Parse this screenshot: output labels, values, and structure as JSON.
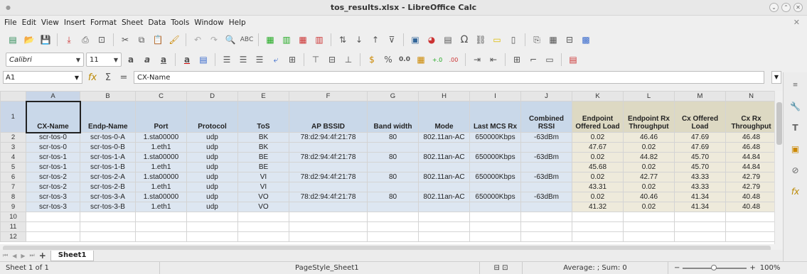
{
  "window": {
    "title": "tos_results.xlsx - LibreOffice Calc"
  },
  "menu": [
    "File",
    "Edit",
    "View",
    "Insert",
    "Format",
    "Sheet",
    "Data",
    "Tools",
    "Window",
    "Help"
  ],
  "format": {
    "font_name": "Calibri",
    "font_size": "11"
  },
  "formula": {
    "cell_ref": "A1",
    "content": "CX-Name"
  },
  "columns": [
    "A",
    "B",
    "C",
    "D",
    "E",
    "F",
    "G",
    "H",
    "I",
    "J",
    "K",
    "L",
    "M",
    "N"
  ],
  "headers": [
    "CX-Name",
    "Endp-Name",
    "Port",
    "Protocol",
    "ToS",
    "AP BSSID",
    "Band width",
    "Mode",
    "Last MCS Rx",
    "Combined RSSI",
    "Endpoint Offered Load",
    "Endpoint Rx Throughput",
    "Cx Offered Load",
    "Cx Rx Throughput"
  ],
  "rows": [
    {
      "num": "2",
      "cells": [
        "scr-tos-0",
        "scr-tos-0-A",
        "1.sta00000",
        "udp",
        "BK",
        "78:d2:94:4f:21:78",
        "80",
        "802.11an-AC",
        "650000Kbps",
        "-63dBm",
        "0.02",
        "46.46",
        "47.69",
        "46.48"
      ]
    },
    {
      "num": "3",
      "cells": [
        "scr-tos-0",
        "scr-tos-0-B",
        "1.eth1",
        "udp",
        "BK",
        "",
        "",
        "",
        "",
        "",
        "47.67",
        "0.02",
        "47.69",
        "46.48"
      ]
    },
    {
      "num": "4",
      "cells": [
        "scr-tos-1",
        "scr-tos-1-A",
        "1.sta00000",
        "udp",
        "BE",
        "78:d2:94:4f:21:78",
        "80",
        "802.11an-AC",
        "650000Kbps",
        "-63dBm",
        "0.02",
        "44.82",
        "45.70",
        "44.84"
      ]
    },
    {
      "num": "5",
      "cells": [
        "scr-tos-1",
        "scr-tos-1-B",
        "1.eth1",
        "udp",
        "BE",
        "",
        "",
        "",
        "",
        "",
        "45.68",
        "0.02",
        "45.70",
        "44.84"
      ]
    },
    {
      "num": "6",
      "cells": [
        "scr-tos-2",
        "scr-tos-2-A",
        "1.sta00000",
        "udp",
        "VI",
        "78:d2:94:4f:21:78",
        "80",
        "802.11an-AC",
        "650000Kbps",
        "-63dBm",
        "0.02",
        "42.77",
        "43.33",
        "42.79"
      ]
    },
    {
      "num": "7",
      "cells": [
        "scr-tos-2",
        "scr-tos-2-B",
        "1.eth1",
        "udp",
        "VI",
        "",
        "",
        "",
        "",
        "",
        "43.31",
        "0.02",
        "43.33",
        "42.79"
      ]
    },
    {
      "num": "8",
      "cells": [
        "scr-tos-3",
        "scr-tos-3-A",
        "1.sta00000",
        "udp",
        "VO",
        "78:d2:94:4f:21:78",
        "80",
        "802.11an-AC",
        "650000Kbps",
        "-63dBm",
        "0.02",
        "40.46",
        "41.34",
        "40.48"
      ]
    },
    {
      "num": "9",
      "cells": [
        "scr-tos-3",
        "scr-tos-3-B",
        "1.eth1",
        "udp",
        "VO",
        "",
        "",
        "",
        "",
        "",
        "41.32",
        "0.02",
        "41.34",
        "40.48"
      ]
    }
  ],
  "empty_rows": [
    "10",
    "11",
    "12"
  ],
  "sheet_tab": "Sheet1",
  "status": {
    "sheet": "Sheet 1 of 1",
    "page_style": "PageStyle_Sheet1",
    "summary": "Average: ; Sum: 0",
    "zoom": "100%"
  }
}
